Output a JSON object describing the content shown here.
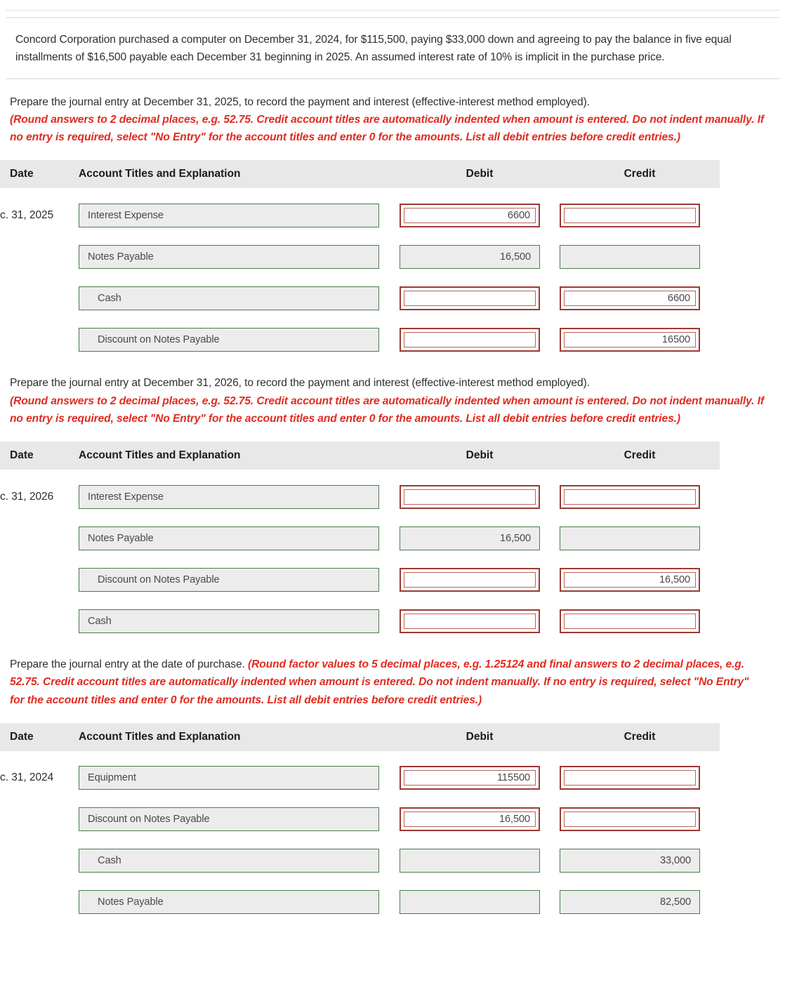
{
  "problem": {
    "text": "Concord Corporation purchased a computer on December 31, 2024, for $115,500, paying $33,000 down and agreeing to pay the balance in five equal installments of $16,500 payable each December 31 beginning in 2025. An assumed interest rate of 10% is implicit in the purchase price."
  },
  "columns": {
    "date": "Date",
    "account": "Account Titles and Explanation",
    "debit": "Debit",
    "credit": "Credit"
  },
  "sections": [
    {
      "prompt": "Prepare the journal entry at December 31, 2025, to record the payment and interest (effective-interest method employed).",
      "note": "(Round answers to 2 decimal places, e.g. 52.75. Credit account titles are automatically indented when amount is entered. Do not indent manually. If no entry is required, select \"No Entry\" for the account titles and enter 0 for the amounts. List all debit entries before credit entries.)",
      "date": "c. 31, 2025",
      "rows": [
        {
          "account": "Interest Expense",
          "indent": false,
          "account_state": "green",
          "debit": "6600",
          "debit_state": "red",
          "credit": "",
          "credit_state": "red"
        },
        {
          "account": "Notes Payable",
          "indent": false,
          "account_state": "green",
          "debit": "16,500",
          "debit_state": "green",
          "credit": "",
          "credit_state": "green"
        },
        {
          "account": "Cash",
          "indent": true,
          "account_state": "green",
          "debit": "",
          "debit_state": "red",
          "credit": "6600",
          "credit_state": "red"
        },
        {
          "account": "Discount on Notes Payable",
          "indent": true,
          "account_state": "green",
          "debit": "",
          "debit_state": "red",
          "credit": "16500",
          "credit_state": "red"
        }
      ]
    },
    {
      "prompt": "Prepare the journal entry at December 31, 2026, to record the payment and interest (effective-interest method employed).",
      "note": "(Round answers to 2 decimal places, e.g. 52.75. Credit account titles are automatically indented when amount is entered. Do not indent manually. If no entry is required, select \"No Entry\" for the account titles and enter 0 for the amounts. List all debit entries before credit entries.)",
      "date": "c. 31, 2026",
      "rows": [
        {
          "account": "Interest Expense",
          "indent": false,
          "account_state": "green",
          "debit": "",
          "debit_state": "red",
          "credit": "",
          "credit_state": "red"
        },
        {
          "account": "Notes Payable",
          "indent": false,
          "account_state": "green",
          "debit": "16,500",
          "debit_state": "green",
          "credit": "",
          "credit_state": "green"
        },
        {
          "account": "Discount on Notes Payable",
          "indent": true,
          "account_state": "green",
          "debit": "",
          "debit_state": "red",
          "credit": "16,500",
          "credit_state": "red"
        },
        {
          "account": "Cash",
          "indent": false,
          "account_state": "green",
          "debit": "",
          "debit_state": "red",
          "credit": "",
          "credit_state": "red"
        }
      ]
    },
    {
      "prompt": "Prepare the journal entry at the date of purchase.",
      "note": "(Round factor values to 5 decimal places, e.g. 1.25124 and final answers to 2 decimal places, e.g. 52.75. Credit account titles are automatically indented when amount is entered. Do not indent manually. If no entry is required, select \"No Entry\" for the account titles and enter 0 for the amounts. List all debit entries before credit entries.)",
      "note_inline": true,
      "date": "c. 31, 2024",
      "rows": [
        {
          "account": "Equipment",
          "indent": false,
          "account_state": "green",
          "debit": "115500",
          "debit_state": "red",
          "credit": "",
          "credit_state": "red"
        },
        {
          "account": "Discount on Notes Payable",
          "indent": false,
          "account_state": "green",
          "debit": "16,500",
          "debit_state": "red",
          "credit": "",
          "credit_state": "red"
        },
        {
          "account": "Cash",
          "indent": true,
          "account_state": "green",
          "debit": "",
          "debit_state": "green",
          "credit": "33,000",
          "credit_state": "green"
        },
        {
          "account": "Notes Payable",
          "indent": true,
          "account_state": "green",
          "debit": "",
          "debit_state": "green",
          "credit": "82,500",
          "credit_state": "green"
        }
      ]
    }
  ],
  "colors": {
    "note_red": "#e02b20",
    "field_green_border": "#4a7c4a",
    "field_green_fill": "#ececec",
    "field_red_border": "#9b3a33",
    "header_band": "#e8e8e8"
  }
}
